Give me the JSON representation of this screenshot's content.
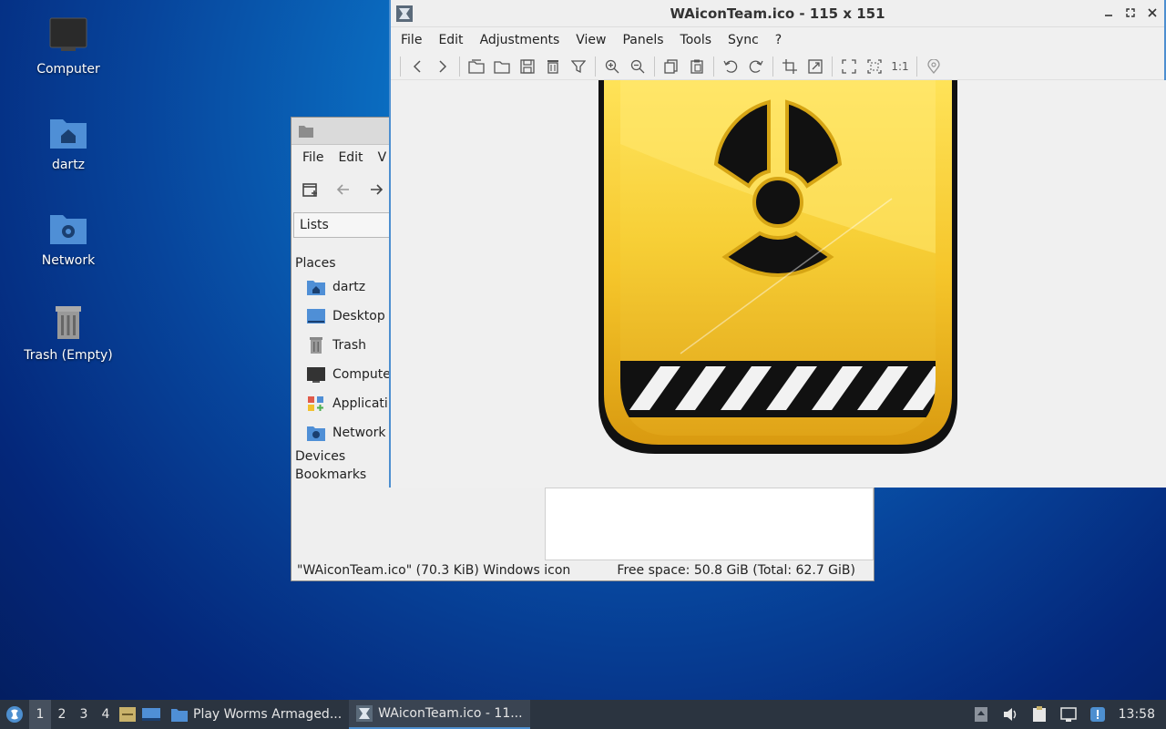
{
  "desktop": {
    "icons": [
      {
        "label": "Computer",
        "icon": "computer-icon"
      },
      {
        "label": "dartz",
        "icon": "home-folder-icon"
      },
      {
        "label": "Network",
        "icon": "network-folder-icon"
      },
      {
        "label": "Trash (Empty)",
        "icon": "trash-icon"
      }
    ]
  },
  "file_manager": {
    "menu": [
      "File",
      "Edit",
      "V"
    ],
    "side_pane_mode": "Lists",
    "sections": {
      "places": "Places",
      "devices": "Devices",
      "bookmarks": "Bookmarks"
    },
    "places": [
      {
        "label": "dartz",
        "icon": "home-folder-icon"
      },
      {
        "label": "Desktop",
        "icon": "desktop-icon"
      },
      {
        "label": "Trash",
        "icon": "trash-icon"
      },
      {
        "label": "Compute",
        "icon": "computer-icon"
      },
      {
        "label": "Applicati",
        "icon": "applications-icon"
      },
      {
        "label": "Network",
        "icon": "network-folder-icon"
      }
    ],
    "status_left": "\"WAiconTeam.ico\" (70.3 KiB) Windows icon",
    "status_right": "Free space: 50.8 GiB (Total: 62.7 GiB)"
  },
  "image_viewer": {
    "title": "WAiconTeam.ico  - 115 x 151",
    "menu": [
      "File",
      "Edit",
      "Adjustments",
      "View",
      "Panels",
      "Tools",
      "Sync",
      "?"
    ],
    "toolbar": [
      "previous-icon",
      "next-icon",
      "open-recent-icon",
      "open-folder-icon",
      "save-icon",
      "delete-icon",
      "filter-icon",
      "zoom-in-icon",
      "zoom-out-icon",
      "copy-icon",
      "paste-icon",
      "rotate-left-icon",
      "rotate-right-icon",
      "crop-icon",
      "resize-icon",
      "fullscreen-icon",
      "fit-window-icon",
      "original-size-icon",
      "location-icon"
    ],
    "original_size_label": "1:1"
  },
  "taskbar": {
    "workspaces": [
      "1",
      "2",
      "3",
      "4"
    ],
    "active_workspace": "1",
    "tasks": [
      {
        "label": "Play Worms Armaged...",
        "icon": "folder-icon"
      },
      {
        "label": "WAiconTeam.ico  - 11...",
        "icon": "image-viewer-icon"
      }
    ],
    "clock": "13:58"
  },
  "colors": {
    "accent": "#4d8fd0",
    "taskbar": "#2b3440",
    "icon_yellow": "#f2c12e",
    "folder_blue": "#4f8fd6"
  }
}
